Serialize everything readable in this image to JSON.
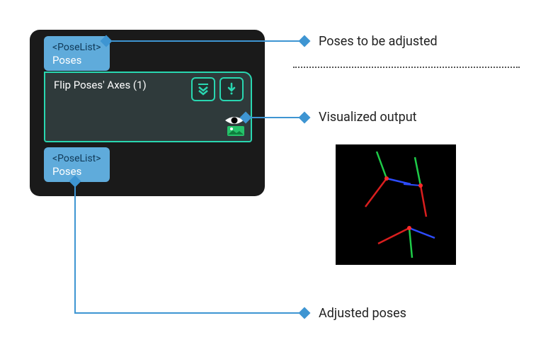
{
  "input_port": {
    "type": "<PoseList>",
    "name": "Poses"
  },
  "output_port": {
    "type": "<PoseList>",
    "name": "Poses"
  },
  "node": {
    "title": "Flip Poses' Axes (1)",
    "icons": {
      "collapse": "collapse-icon",
      "download": "download-icon",
      "visualize": "visualize-icon"
    }
  },
  "annotations": {
    "input": "Poses to be adjusted",
    "visual": "Visualized output",
    "output": "Adjusted poses"
  },
  "preview_axes": {
    "colors": {
      "x": "#d91e1e",
      "y": "#1ecb48",
      "z": "#2d4cff"
    }
  },
  "colors": {
    "accent": "#3e95d2",
    "teal": "#29d6b0",
    "port_bg": "#5fabdb",
    "panel_bg": "#1a1a1a",
    "card_bg": "#2f3a3b"
  }
}
